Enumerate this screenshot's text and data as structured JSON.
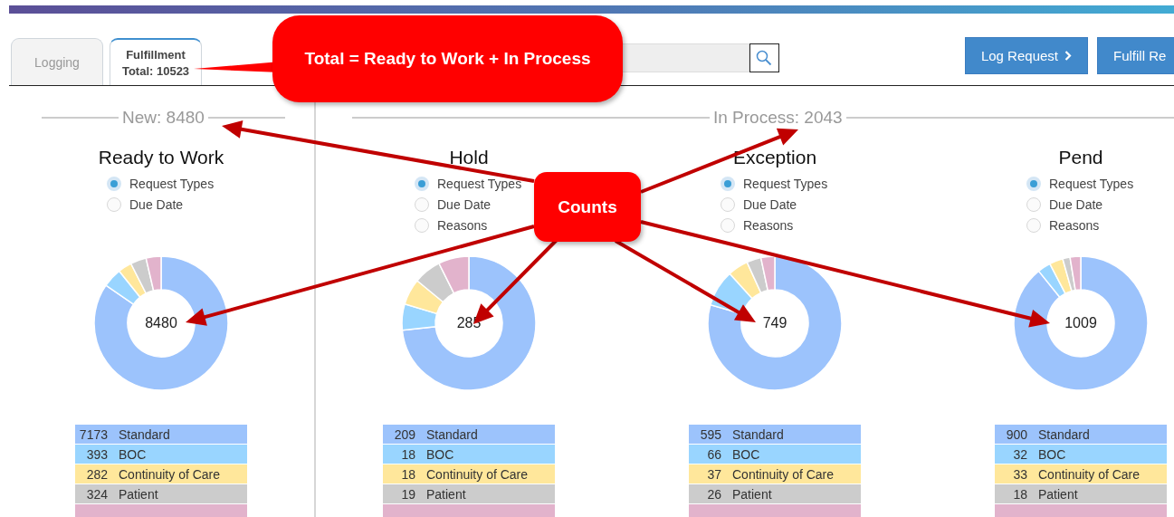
{
  "tabs": [
    {
      "label": "Logging",
      "selected": false
    },
    {
      "label": "Fulfillment",
      "subtitle": "Total: 10523",
      "selected": true
    }
  ],
  "buttons": [
    {
      "label": "Log Request",
      "kind": "next"
    },
    {
      "label": "Fulfill Re",
      "kind": "plain"
    }
  ],
  "groups": [
    {
      "label": "New: 8480",
      "panels": [
        {
          "title": "Ready to Work",
          "options": [
            {
              "label": "Request Types",
              "selected": true
            },
            {
              "label": "Due Date",
              "selected": false
            }
          ],
          "total": "8480",
          "legend": [
            {
              "count": "7173",
              "label": "Standard",
              "color": "#9cc3fc"
            },
            {
              "count": "393",
              "label": "BOC",
              "color": "#99d5ff"
            },
            {
              "count": "282",
              "label": "Continuity of Care",
              "color": "#ffe79b"
            },
            {
              "count": "324",
              "label": "Patient",
              "color": "#cccccc"
            },
            {
              "color": "#e2b3cc"
            }
          ]
        }
      ]
    },
    {
      "label": "In Process: 2043",
      "panels": [
        {
          "title": "Hold",
          "options": [
            {
              "label": "Request Types",
              "selected": true
            },
            {
              "label": "Due Date",
              "selected": false
            },
            {
              "label": "Reasons",
              "selected": false
            }
          ],
          "total": "285",
          "legend": [
            {
              "count": "209",
              "label": "Standard",
              "color": "#9cc3fc"
            },
            {
              "count": "18",
              "label": "BOC",
              "color": "#99d5ff"
            },
            {
              "count": "18",
              "label": "Continuity of Care",
              "color": "#ffe79b"
            },
            {
              "count": "19",
              "label": "Patient",
              "color": "#cccccc"
            },
            {
              "color": "#e2b3cc"
            }
          ]
        },
        {
          "title": "Exception",
          "options": [
            {
              "label": "Request Types",
              "selected": true
            },
            {
              "label": "Due Date",
              "selected": false
            },
            {
              "label": "Reasons",
              "selected": false
            }
          ],
          "total": "749",
          "legend": [
            {
              "count": "595",
              "label": "Standard",
              "color": "#9cc3fc"
            },
            {
              "count": "66",
              "label": "BOC",
              "color": "#99d5ff"
            },
            {
              "count": "37",
              "label": "Continuity of Care",
              "color": "#ffe79b"
            },
            {
              "count": "26",
              "label": "Patient",
              "color": "#cccccc"
            },
            {
              "color": "#e2b3cc"
            }
          ]
        },
        {
          "title": "Pend",
          "options": [
            {
              "label": "Request Types",
              "selected": true
            },
            {
              "label": "Due Date",
              "selected": false
            },
            {
              "label": "Reasons",
              "selected": false
            }
          ],
          "total": "1009",
          "legend": [
            {
              "count": "900",
              "label": "Standard",
              "color": "#9cc3fc"
            },
            {
              "count": "32",
              "label": "BOC",
              "color": "#99d5ff"
            },
            {
              "count": "33",
              "label": "Continuity of Care",
              "color": "#ffe79b"
            },
            {
              "count": "18",
              "label": "Patient",
              "color": "#cccccc"
            },
            {
              "color": "#e2b3cc"
            }
          ]
        }
      ]
    }
  ],
  "annotations": [
    {
      "kind": "total",
      "text": "Total = Ready to Work + In Process"
    },
    {
      "kind": "counts",
      "text": "Counts"
    }
  ]
}
